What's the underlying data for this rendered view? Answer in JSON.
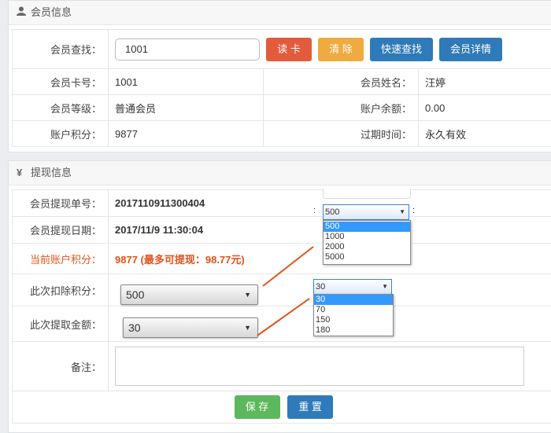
{
  "member_panel": {
    "title": "会员信息",
    "search_label": "会员查找：",
    "search_value": "1001",
    "buttons": {
      "read_card": "读 卡",
      "clear": "清 除",
      "quick_search": "快速查找",
      "details": "会员详情"
    },
    "card_no_label": "会员卡号：",
    "card_no": "1001",
    "name_label": "会员姓名：",
    "name": "汪婷",
    "level_label": "会员等级：",
    "level": "普通会员",
    "balance_label": "账户余额：",
    "balance": "0.00",
    "points_label": "账户积分：",
    "points": "9877",
    "expire_label": "过期时间：",
    "expire": "永久有效"
  },
  "withdraw_panel": {
    "title": "提现信息",
    "order_label": "会员提现单号：",
    "order_no": "2017110911300404",
    "date_label": "会员提现日期：",
    "date": "2017/11/9 11:30:04",
    "current_points_label": "当前账户积分：",
    "current_points": "9877 (最多可提现：98.77元)",
    "deduct_label": "此次扣除积分：",
    "deduct_value": "500",
    "amount_label": "此次提取金额：",
    "amount_value": "30",
    "note_label": "备注：",
    "save": "保 存",
    "reset": "重 置"
  },
  "callout_points": {
    "selected": "500",
    "options": [
      "500",
      "1000",
      "2000",
      "5000"
    ]
  },
  "callout_amount": {
    "selected": "30",
    "options": [
      "30",
      "70",
      "150",
      "180"
    ]
  },
  "colors": {
    "annotation_line": "#e0531a",
    "highlight": "#3399ff"
  }
}
